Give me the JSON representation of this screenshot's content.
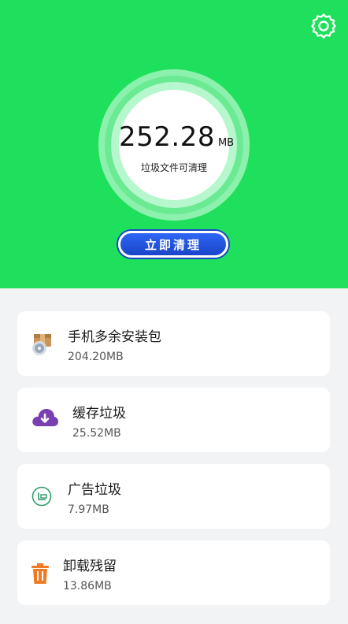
{
  "hero": {
    "size_value": "252.28",
    "size_unit": "MB",
    "caption": "垃圾文件可清理",
    "clean_button": "立即清理",
    "settings_icon": "gear-icon",
    "background": "#1fe05c"
  },
  "cards": [
    {
      "title": "手机多余安装包",
      "size": "204.20MB",
      "icon": "package-icon"
    },
    {
      "title": "缓存垃圾",
      "size": "25.52MB",
      "icon": "cloud-download-icon"
    },
    {
      "title": "广告垃圾",
      "size": "7.97MB",
      "icon": "ad-icon"
    },
    {
      "title": "卸载残留",
      "size": "13.86MB",
      "icon": "trash-icon"
    }
  ]
}
